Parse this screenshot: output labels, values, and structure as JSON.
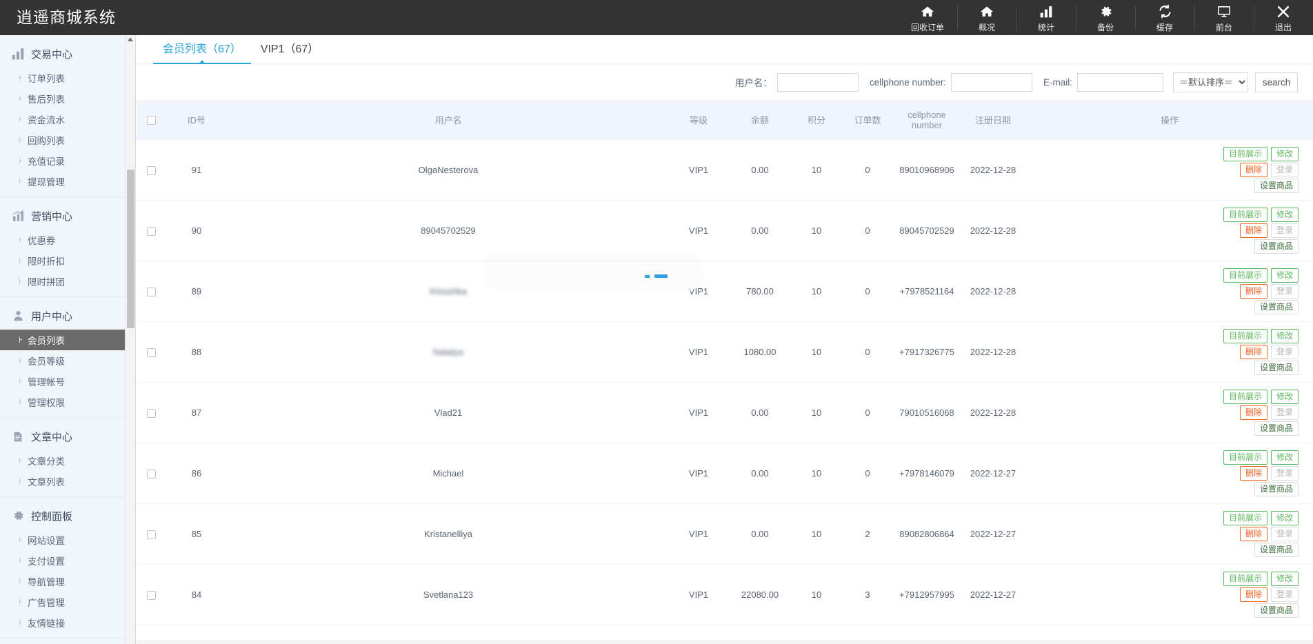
{
  "app": {
    "title": "逍遥商城系统",
    "accent": "#2aa3d8",
    "topbar_bg": "#333333",
    "money_color": "#f0601f",
    "link_color": "#3a80d0"
  },
  "topnav": [
    {
      "label": "回收订单",
      "icon": "home-icon"
    },
    {
      "label": "概况",
      "icon": "home-icon"
    },
    {
      "label": "统计",
      "icon": "bar-chart-icon"
    },
    {
      "label": "备份",
      "icon": "gear-icon"
    },
    {
      "label": "缓存",
      "icon": "refresh-icon"
    },
    {
      "label": "前台",
      "icon": "monitor-icon"
    },
    {
      "label": "退出",
      "icon": "close-icon"
    }
  ],
  "sidebar": {
    "groups": [
      {
        "label": "交易中心",
        "icon": "bar-chart-icon",
        "items": [
          {
            "label": "订单列表",
            "active": false
          },
          {
            "label": "售后列表",
            "active": false
          },
          {
            "label": "资金流水",
            "active": false
          },
          {
            "label": "回购列表",
            "active": false
          },
          {
            "label": "充值记录",
            "active": false
          },
          {
            "label": "提现管理",
            "active": false
          }
        ]
      },
      {
        "label": "营销中心",
        "icon": "trend-chart-icon",
        "items": [
          {
            "label": "优惠券",
            "active": false
          },
          {
            "label": "限时折扣",
            "active": false
          },
          {
            "label": "限时拼团",
            "active": false
          }
        ]
      },
      {
        "label": "用户中心",
        "icon": "user-icon",
        "items": [
          {
            "label": "会员列表",
            "active": true
          },
          {
            "label": "会员等级",
            "active": false
          },
          {
            "label": "管理帐号",
            "active": false
          },
          {
            "label": "管理权限",
            "active": false
          }
        ]
      },
      {
        "label": "文章中心",
        "icon": "document-icon",
        "items": [
          {
            "label": "文章分类",
            "active": false
          },
          {
            "label": "文章列表",
            "active": false
          }
        ]
      },
      {
        "label": "控制面板",
        "icon": "gear-icon",
        "items": [
          {
            "label": "网站设置",
            "active": false
          },
          {
            "label": "支付设置",
            "active": false
          },
          {
            "label": "导航管理",
            "active": false
          },
          {
            "label": "广告管理",
            "active": false
          },
          {
            "label": "友情链接",
            "active": false
          }
        ]
      }
    ]
  },
  "tabs": [
    {
      "label": "会员列表（67）",
      "active": true
    },
    {
      "label": "VIP1（67）",
      "active": false
    }
  ],
  "search": {
    "username_label": "用户名：",
    "username_value": "",
    "username_placeholder": "",
    "cellphone_label": "cellphone number:",
    "cellphone_value": "",
    "cellphone_placeholder": "",
    "email_label": "E-mail:",
    "email_value": "",
    "email_placeholder": "",
    "sort_selected": "＝默认排序＝",
    "sort_options": [
      "＝默认排序＝"
    ],
    "search_button": "search"
  },
  "table": {
    "columns": [
      "ID号",
      "用户名",
      "等级",
      "余额",
      "积分",
      "订单数",
      "cellphone number",
      "注册日期",
      "操作"
    ],
    "op_buttons": {
      "show": "目前展示",
      "edit": "修改",
      "delete": "删除",
      "login": "登录",
      "goods": "设置商品"
    },
    "rows": [
      {
        "checked": false,
        "id": "91",
        "username": "OlgaNesterova",
        "blurred": false,
        "level": "VIP1",
        "balance": "0.00",
        "points": "10",
        "orders": "0",
        "cellphone": "89010968906",
        "date": "2022-12-28"
      },
      {
        "checked": false,
        "id": "90",
        "username": "89045702529",
        "blurred": false,
        "level": "VIP1",
        "balance": "0.00",
        "points": "10",
        "orders": "0",
        "cellphone": "89045702529",
        "date": "2022-12-28"
      },
      {
        "checked": false,
        "id": "89",
        "username": "Kiriushka",
        "blurred": true,
        "level": "VIP1",
        "balance": "780.00",
        "points": "10",
        "orders": "0",
        "cellphone": "+7978521164",
        "date": "2022-12-28"
      },
      {
        "checked": false,
        "id": "88",
        "username": "Natalya",
        "blurred": true,
        "level": "VIP1",
        "balance": "1080.00",
        "points": "10",
        "orders": "0",
        "cellphone": "+7917326775",
        "date": "2022-12-28"
      },
      {
        "checked": false,
        "id": "87",
        "username": "Vlad21",
        "blurred": false,
        "level": "VIP1",
        "balance": "0.00",
        "points": "10",
        "orders": "0",
        "cellphone": "79010516068",
        "date": "2022-12-28"
      },
      {
        "checked": false,
        "id": "86",
        "username": "Michael",
        "blurred": false,
        "level": "VIP1",
        "balance": "0.00",
        "points": "10",
        "orders": "0",
        "cellphone": "+7978146079",
        "date": "2022-12-27"
      },
      {
        "checked": false,
        "id": "85",
        "username": "Kristanelliya",
        "blurred": false,
        "level": "VIP1",
        "balance": "0.00",
        "points": "10",
        "orders": "2",
        "cellphone": "89082806864",
        "date": "2022-12-27"
      },
      {
        "checked": false,
        "id": "84",
        "username": "Svetlana123",
        "blurred": false,
        "level": "VIP1",
        "balance": "22080.00",
        "points": "10",
        "orders": "3",
        "cellphone": "+7912957995",
        "date": "2022-12-27"
      }
    ]
  }
}
